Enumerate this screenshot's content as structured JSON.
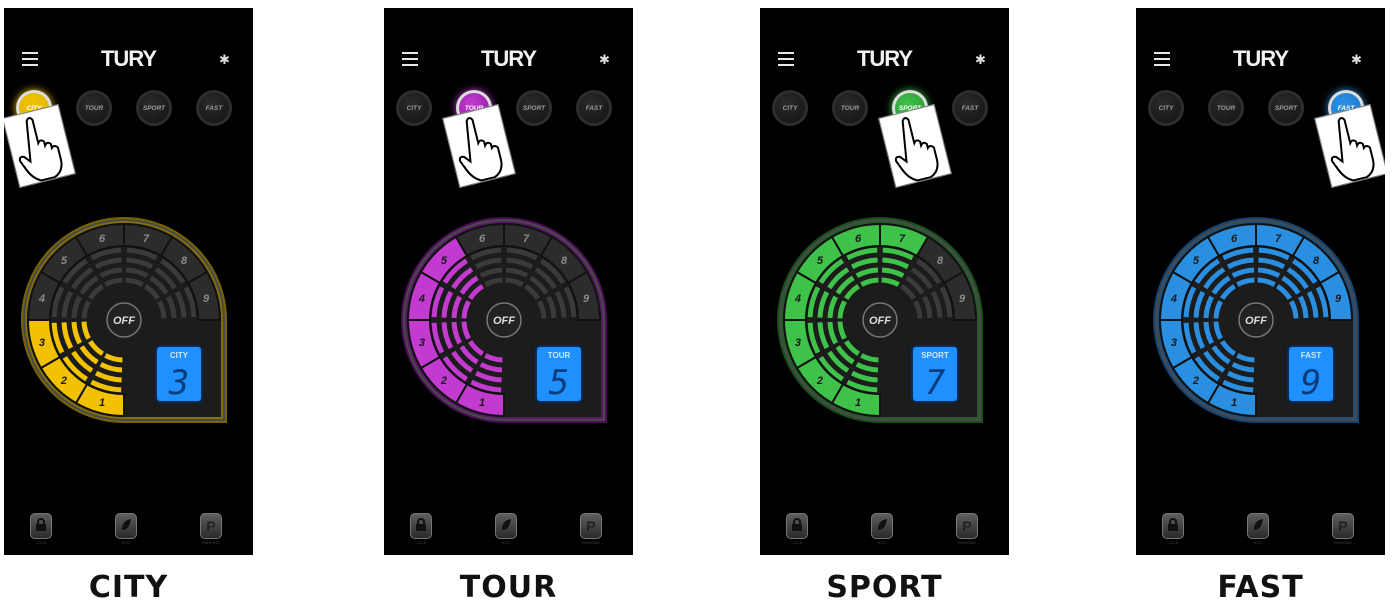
{
  "brand": "TURY",
  "mode_buttons": [
    "CITY",
    "TOUR",
    "SPORT",
    "FAST"
  ],
  "off_label": "OFF",
  "gauge_numbers": [
    "1",
    "2",
    "3",
    "4",
    "5",
    "6",
    "7",
    "8",
    "9"
  ],
  "bottom_buttons": [
    {
      "glyph": "",
      "label": "LOCK",
      "icon": "lock-icon"
    },
    {
      "glyph": "",
      "label": "ECO",
      "icon": "leaf-icon"
    },
    {
      "glyph": "P",
      "label": "PARKING",
      "icon": "parking-icon"
    }
  ],
  "panels": [
    {
      "caption": "CITY",
      "mode": "CITY",
      "level": "3",
      "active_index": 0,
      "color": "#f2c200",
      "glow": "#d8b400",
      "display_color": "#1e90ff"
    },
    {
      "caption": "TOUR",
      "mode": "TOUR",
      "level": "5",
      "active_index": 1,
      "color": "#c33ad0",
      "glow": "#8a1c9e",
      "display_color": "#1e90ff"
    },
    {
      "caption": "SPORT",
      "mode": "SPORT",
      "level": "7",
      "active_index": 2,
      "color": "#3fc24a",
      "glow": "#2a8f33",
      "display_color": "#1e90ff"
    },
    {
      "caption": "FAST",
      "mode": "FAST",
      "level": "9",
      "active_index": 3,
      "color": "#2a8fe0",
      "glow": "#1e78d0",
      "display_color": "#1e90ff"
    }
  ]
}
